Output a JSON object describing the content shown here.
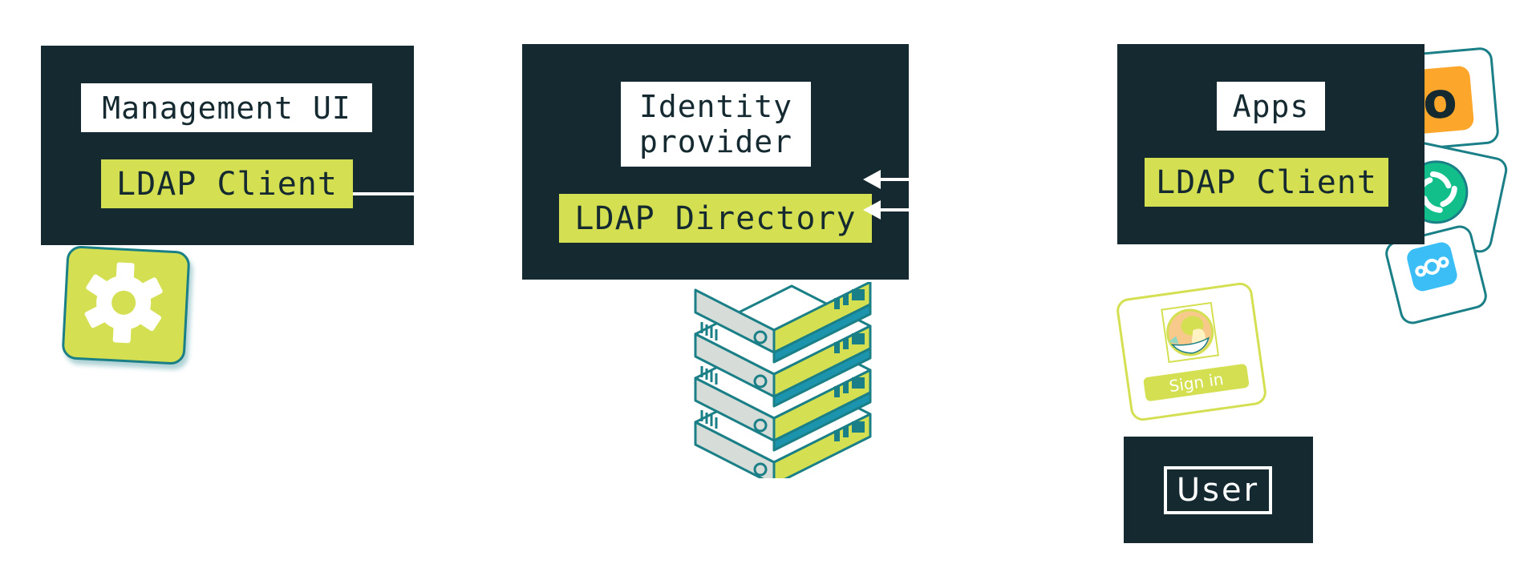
{
  "diagram": {
    "management": {
      "title": "Management UI",
      "client_label": "LDAP Client",
      "icon": "gear-icon"
    },
    "identity_provider": {
      "title_line1": "Identity",
      "title_line2": "provider",
      "directory_label": "LDAP Directory",
      "illustration": "server-stack-icon"
    },
    "apps": {
      "title": "Apps",
      "client_label": "LDAP Client",
      "app_icons": [
        "ollama-o-icon",
        "element-matrix-icon",
        "nextcloud-icon"
      ]
    },
    "login_card": {
      "button_label": "Sign in",
      "avatar": "avatar-illustration"
    },
    "user": {
      "label": "User"
    }
  },
  "colors": {
    "dark": "#142a30",
    "lime": "#d4e051",
    "teal": "#1a7f86",
    "orange": "#fca72b",
    "green": "#12bf8a",
    "blue": "#3bbef5"
  }
}
